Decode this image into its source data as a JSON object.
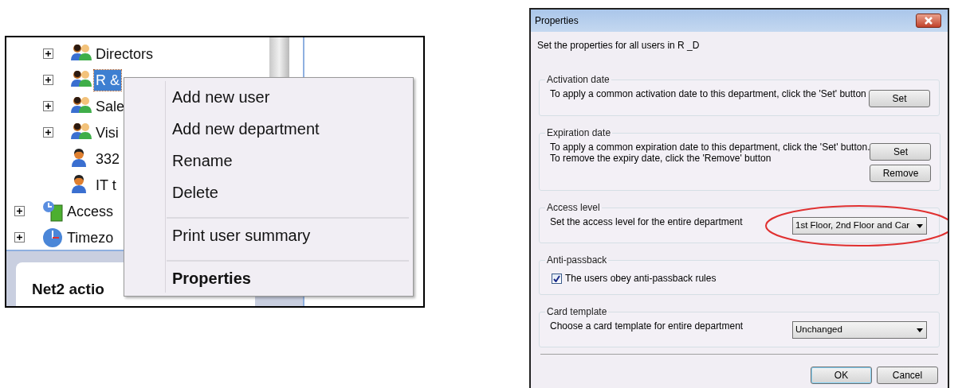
{
  "tree": {
    "child_items": [
      {
        "label": "Directors",
        "kind": "department",
        "expanded": false,
        "selected": false
      },
      {
        "label": "R &",
        "kind": "department",
        "expanded": false,
        "selected": true
      },
      {
        "label": "Sale",
        "kind": "department",
        "expanded": false,
        "selected": false
      },
      {
        "label": "Visi",
        "kind": "department",
        "expanded": false,
        "selected": false
      },
      {
        "label": "332",
        "kind": "user",
        "selected": false
      },
      {
        "label": "IT t",
        "kind": "user",
        "selected": false
      }
    ],
    "top_items": [
      {
        "label": "Access",
        "kind": "access",
        "expanded": false,
        "selected": false
      },
      {
        "label": "Timezo",
        "kind": "timezone",
        "expanded": false,
        "selected": false
      }
    ]
  },
  "bottom_tab": {
    "label": "Net2 actio"
  },
  "context_menu": {
    "items": [
      {
        "label": "Add new user",
        "separator_before": false,
        "default": false
      },
      {
        "label": "Add new department",
        "separator_before": false,
        "default": false
      },
      {
        "label": "Rename",
        "separator_before": false,
        "default": false
      },
      {
        "label": "Delete",
        "separator_before": false,
        "default": false
      },
      {
        "label": "Print user summary",
        "separator_before": true,
        "default": false
      },
      {
        "label": "Properties",
        "separator_before": true,
        "default": true
      }
    ]
  },
  "dialog": {
    "title": "Properties",
    "intro": "Set the properties for all users in R _D",
    "groups": [
      {
        "kind": "buttons",
        "title": "Activation date",
        "lines": [
          "To apply a common activation date to this department, click the 'Set' button"
        ],
        "buttons": [
          "Set"
        ]
      },
      {
        "kind": "buttons",
        "title": "Expiration date",
        "lines": [
          "To apply a common expiration date to this department, click the 'Set' button.",
          "To remove the expiry date, click the 'Remove' button"
        ],
        "buttons": [
          "Set",
          "Remove"
        ]
      },
      {
        "kind": "dropdown",
        "title": "Access level",
        "lines": [
          "Set the access level for the entire department"
        ],
        "value": "1st Floor, 2nd Floor and Car",
        "highlighted": true
      },
      {
        "kind": "checkbox",
        "title": "Anti-passback",
        "label": "The users obey anti-passback rules",
        "checked": true
      },
      {
        "kind": "dropdown",
        "title": "Card template",
        "lines": [
          "Choose a card template for entire department"
        ],
        "value": "Unchanged",
        "highlighted": false
      }
    ],
    "buttons": [
      {
        "label": "OK",
        "default": true
      },
      {
        "label": "Cancel",
        "default": false
      }
    ]
  }
}
